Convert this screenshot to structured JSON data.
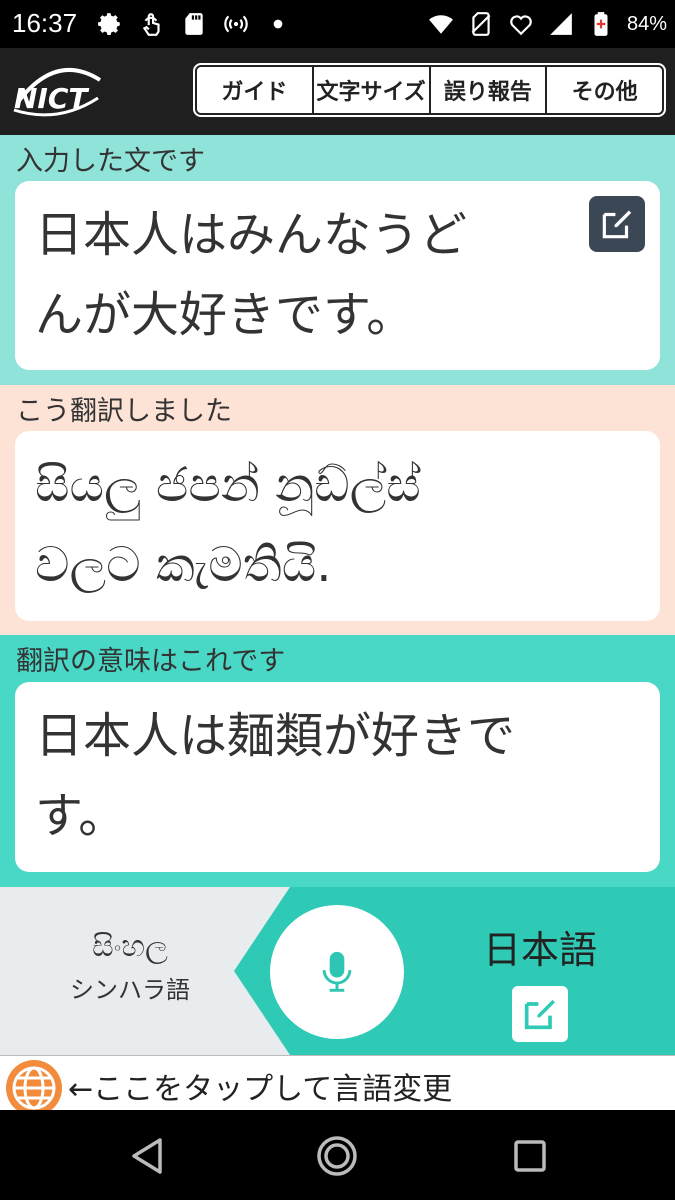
{
  "status_bar": {
    "time": "16:37",
    "battery_percent": "84%",
    "icons_left": [
      "gear-icon",
      "touch-icon",
      "sd-card-icon",
      "broadcast-icon",
      "dot-icon"
    ],
    "icons_right": [
      "wifi-icon",
      "no-sim-icon",
      "data-saver-icon",
      "signal-icon",
      "battery-icon"
    ]
  },
  "header": {
    "logo_text": "NICT",
    "nav": [
      "ガイド",
      "文字サイズ",
      "誤り報告",
      "その他"
    ]
  },
  "input_section": {
    "label": "入力した文です",
    "text_lines": [
      "日本人はみんなうど",
      "んが大好きです。"
    ]
  },
  "translation_section": {
    "label": "こう翻訳しました",
    "text_lines": [
      "සියලු ජපන් නූඩ්ල්ස්",
      "වලට කැමතියි."
    ]
  },
  "back_translation_section": {
    "label": "翻訳の意味はこれです",
    "text_lines": [
      "日本人は麺類が好きで",
      "す。"
    ]
  },
  "languages": {
    "source_native": "සිංහල",
    "source_japanese": "シンハラ語",
    "target": "日本語"
  },
  "language_change_hint": "←ここをタップして言語変更",
  "colors": {
    "input_bg": "#8fe3d8",
    "translation_bg": "#fde3d6",
    "back_translation_bg": "#49d7c6",
    "target_lang_bg": "#2ecab6",
    "mic_color": "#2ec6b3",
    "globe_color": "#f28b3c"
  }
}
